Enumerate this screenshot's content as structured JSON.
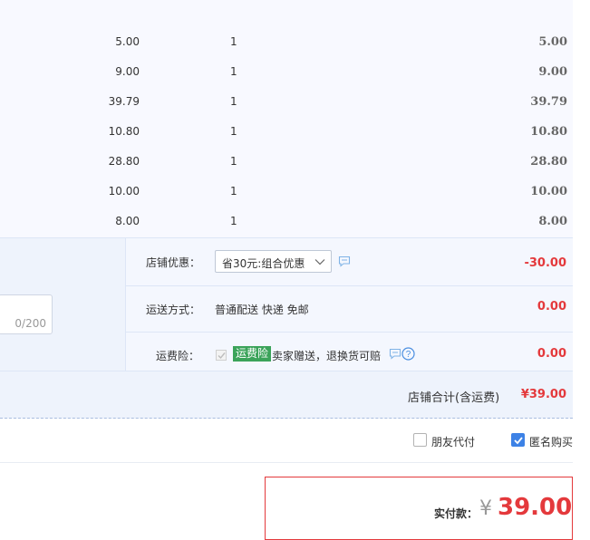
{
  "items": [
    {
      "price": "5.00",
      "quantity": "1",
      "subtotal": "5.00"
    },
    {
      "price": "9.00",
      "quantity": "1",
      "subtotal": "9.00"
    },
    {
      "price": "39.79",
      "quantity": "1",
      "subtotal": "39.79"
    },
    {
      "price": "10.80",
      "quantity": "1",
      "subtotal": "10.80"
    },
    {
      "price": "28.80",
      "quantity": "1",
      "subtotal": "28.80"
    },
    {
      "price": "10.00",
      "quantity": "1",
      "subtotal": "10.00"
    },
    {
      "price": "8.00",
      "quantity": "1",
      "subtotal": "8.00"
    }
  ],
  "shop": {
    "discount_label": "店铺优惠：",
    "discount_option": "省30元:组合优惠",
    "discount_value": "-30.00",
    "shipping_label": "运送方式：",
    "shipping_method": "普通配送 快递 免邮",
    "shipping_value": "0.00",
    "insurance_label": "运费险：",
    "insurance_badge": "运费险",
    "insurance_text": "卖家赠送，退换货可赔",
    "insurance_value": "0.00",
    "message_count": "0/200",
    "total_label": "店铺合计(含运费)",
    "total_value": "¥39.00"
  },
  "options": {
    "friend_pay_label": "朋友代付",
    "anonymous_label": "匿名购买",
    "anonymous_checked": true
  },
  "payment": {
    "label": "实付款：",
    "currency": "¥",
    "amount": "39.00"
  },
  "colors": {
    "accent_red": "#e4393c",
    "checkbox_blue": "#3d82e6",
    "badge_green": "#3ba35a"
  },
  "icons": [
    "chevron-down-icon",
    "chat-icon",
    "help-icon",
    "checkmark-icon"
  ]
}
